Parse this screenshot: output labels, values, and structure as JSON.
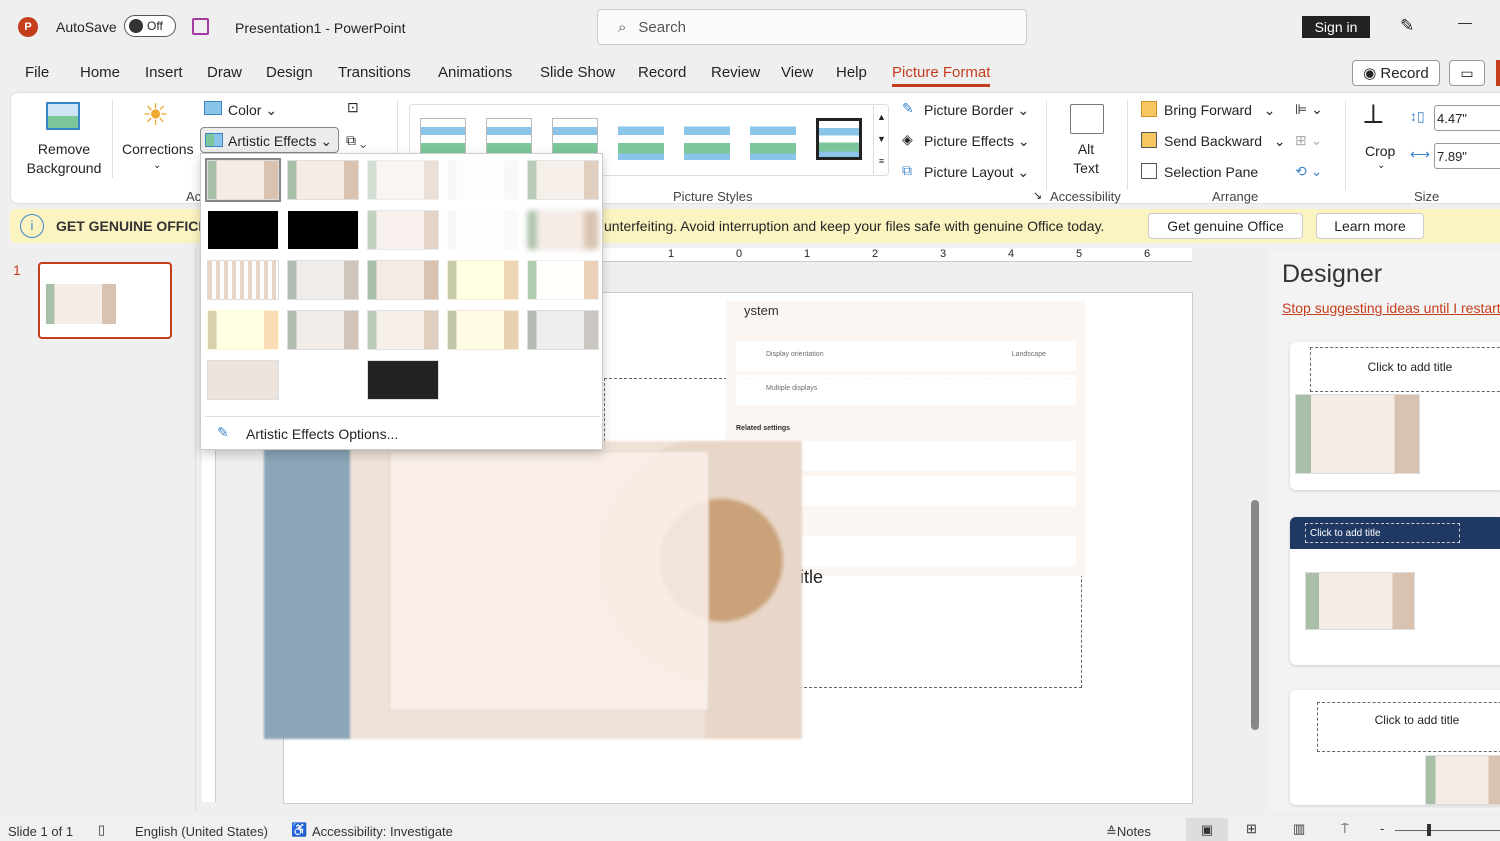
{
  "titlebar": {
    "autosave_label": "AutoSave",
    "autosave_state": "Off",
    "doc_title": "Presentation1",
    "app_name": "PowerPoint",
    "separator": "-",
    "search_placeholder": "Search",
    "sign_in": "Sign in",
    "minimize": "—"
  },
  "menu": {
    "tabs": [
      "File",
      "Home",
      "Insert",
      "Draw",
      "Design",
      "Transitions",
      "Animations",
      "Slide Show",
      "Record",
      "Review",
      "View",
      "Help",
      "Picture Format"
    ],
    "active": "Picture Format",
    "record_button": "Record"
  },
  "ribbon": {
    "remove_background": [
      "Remove",
      "Background"
    ],
    "corrections": "Corrections",
    "color": "Color",
    "artistic_effects": "Artistic Effects",
    "adjust_group_partial": "Ac",
    "picture_styles_group": "Picture Styles",
    "picture_border": "Picture Border",
    "picture_effects": "Picture Effects",
    "picture_layout": "Picture Layout",
    "alt_text": [
      "Alt",
      "Text"
    ],
    "accessibility_group": "Accessibility",
    "bring_forward": "Bring Forward",
    "send_backward": "Send Backward",
    "selection_pane": "Selection Pane",
    "arrange_group": "Arrange",
    "crop": "Crop",
    "height": "4.47\"",
    "width": "7.89\"",
    "size_group": "Size"
  },
  "notification": {
    "title": "GET GENUINE OFFICE",
    "message_partial": "unterfeiting. Avoid interruption and keep your files safe with genuine Office today.",
    "get_button": "Get genuine Office",
    "learn_button": "Learn more"
  },
  "gallery": {
    "options_label": "Artistic Effects Options...",
    "rows": [
      5,
      5,
      5,
      5,
      3
    ],
    "selected": 0
  },
  "ruler": {
    "labels": [
      "1",
      "0",
      "1",
      "2",
      "3",
      "4",
      "5",
      "6"
    ]
  },
  "thumbnails": [
    {
      "number": "1"
    }
  ],
  "slide": {
    "title_fragment": "itle",
    "screenshot_heading": "ystem",
    "rows": [
      "Display orientation",
      "Multiple displays",
      "Related settings"
    ],
    "orientation_value": "Landscape"
  },
  "designer": {
    "title": "Designer",
    "stop_link": "Stop suggesting ideas until I restart",
    "card_title": "Click to add title"
  },
  "status": {
    "slide": "Slide 1 of 1",
    "language": "English (United States)",
    "accessibility": "Accessibility: Investigate",
    "notes": "Notes"
  },
  "colors": {
    "accent": "#c43e1c",
    "notification_bg": "#fbf4c1",
    "designer_dark": "#1f3864"
  }
}
